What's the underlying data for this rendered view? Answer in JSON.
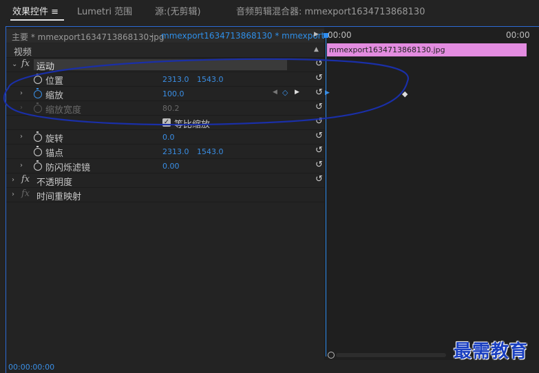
{
  "tabs": [
    {
      "label": "效果控件",
      "menu_icon": "≡"
    },
    {
      "label": "Lumetri 范围"
    },
    {
      "label": "源:(无剪辑)"
    },
    {
      "label": "音频剪辑混合器: mmexport1634713868130"
    }
  ],
  "source": {
    "master_label": "主要 * mmexport1634713868130.jpg",
    "clip_label": "mmexport1634713868130 * mmexport1..."
  },
  "section": {
    "video_label": "视频"
  },
  "motion": {
    "label": "运动",
    "position": {
      "label": "位置",
      "x": "2313.0",
      "y": "1543.0"
    },
    "scale": {
      "label": "缩放",
      "value": "100.0"
    },
    "scale_width": {
      "label": "缩放宽度",
      "value": "80.2"
    },
    "uniform_scale": {
      "label": "等比缩放",
      "checked": true
    },
    "rotation": {
      "label": "旋转",
      "value": "0.0"
    },
    "anchor": {
      "label": "锚点",
      "x": "2313.0",
      "y": "1543.0"
    },
    "anti_flicker": {
      "label": "防闪烁滤镜",
      "value": "0.00"
    }
  },
  "opacity": {
    "label": "不透明度"
  },
  "time_remap": {
    "label": "时间重映射"
  },
  "timeline": {
    "tc_start": "00:00",
    "tc_end": "00:00",
    "clip_name": "mmexport1634713868130.jpg"
  },
  "footer": {
    "timecode": "00:00:00:00"
  },
  "watermark": "最需教育",
  "colors": {
    "accent": "#3a8fe6",
    "clip": "#e38ce0",
    "annotation": "#1a2fa8"
  }
}
